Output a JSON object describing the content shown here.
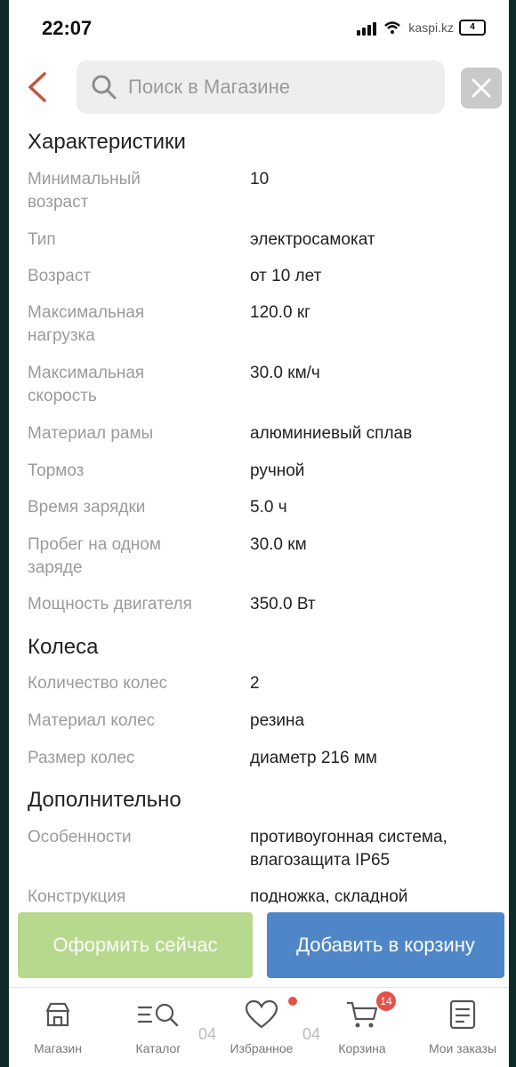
{
  "status_bar": {
    "time": "22:07",
    "watermark": "kaspi.kz",
    "battery": "4"
  },
  "search": {
    "placeholder": "Поиск в Магазине"
  },
  "sections": [
    {
      "title": "Характеристики",
      "rows": [
        {
          "label": "Минимальный\nвозраст",
          "value": "10"
        },
        {
          "label": "Тип",
          "value": "электросамокат"
        },
        {
          "label": "Возраст",
          "value": "от 10 лет"
        },
        {
          "label": "Максимальная\nнагрузка",
          "value": "120.0 кг"
        },
        {
          "label": "Максимальная\nскорость",
          "value": "30.0 км/ч"
        },
        {
          "label": "Материал рамы",
          "value": "алюминиевый сплав"
        },
        {
          "label": "Тормоз",
          "value": "ручной"
        },
        {
          "label": "Время зарядки",
          "value": "5.0 ч"
        },
        {
          "label": "Пробег на одном\nзаряде",
          "value": "30.0 км"
        },
        {
          "label": "Мощность двигателя",
          "value": "350.0 Вт"
        }
      ]
    },
    {
      "title": "Колеса",
      "rows": [
        {
          "label": "Количество колес",
          "value": "2"
        },
        {
          "label": "Материал колес",
          "value": "резина"
        },
        {
          "label": "Размер колес",
          "value": "диаметр 216 мм"
        }
      ]
    },
    {
      "title": "Дополнительно",
      "rows": [
        {
          "label": "Особенности",
          "value": "противоугонная система,\nвлагозащита IP65"
        },
        {
          "label": "Конструкция",
          "value": "подножка, складной"
        }
      ]
    }
  ],
  "actions": {
    "buy_now": "Оформить сейчас",
    "add_to_cart": "Добавить в корзину"
  },
  "tabbar": {
    "items": [
      {
        "label": "Магазин",
        "icon": "store-icon"
      },
      {
        "label": "Каталог",
        "icon": "catalog-search-icon"
      },
      {
        "label": "Избранное",
        "icon": "heart-icon"
      },
      {
        "label": "Корзина",
        "icon": "cart-icon",
        "badge": "14"
      },
      {
        "label": "Мои заказы",
        "icon": "orders-icon"
      }
    ],
    "overlay_marks": [
      "04",
      "04"
    ]
  },
  "colors": {
    "accent_red": "#e2524a",
    "buy_now_green": "#b6d98d",
    "cart_blue": "#4e86c8",
    "back_arrow": "#c0563f"
  }
}
